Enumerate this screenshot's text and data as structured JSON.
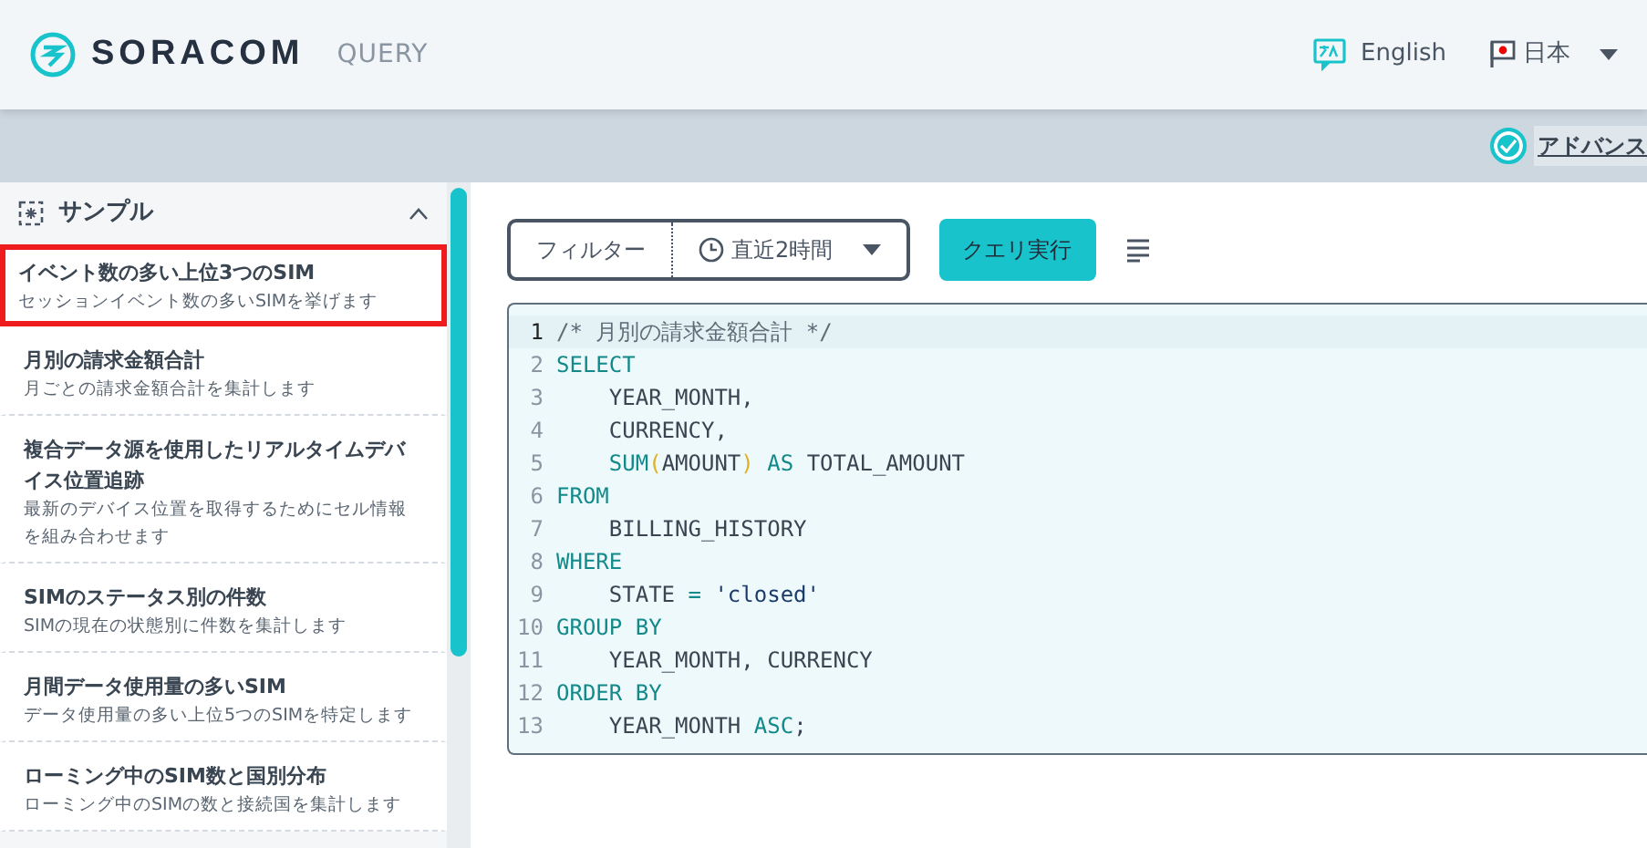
{
  "header": {
    "logo": "SORACOM",
    "product": "QUERY",
    "language": "English",
    "region": "日本"
  },
  "advanced_toggle": {
    "label": "アドバンス",
    "checked": true
  },
  "sidebar": {
    "title": "サンプル",
    "expanded": true,
    "items": [
      {
        "title": "イベント数の多い上位3つのSIM",
        "description": "セッションイベント数の多いSIMを挙げます",
        "selected": true
      },
      {
        "title": "月別の請求金額合計",
        "description": "月ごとの請求金額合計を集計します",
        "selected": false
      },
      {
        "title": "複合データ源を使用したリアルタイムデバイス位置追跡",
        "description": "最新のデバイス位置を取得するためにセル情報を組み合わせます",
        "selected": false
      },
      {
        "title": "SIMのステータス別の件数",
        "description": "SIMの現在の状態別に件数を集計します",
        "selected": false
      },
      {
        "title": "月間データ使用量の多いSIM",
        "description": "データ使用量の多い上位5つのSIMを特定します",
        "selected": false
      },
      {
        "title": "ローミング中のSIM数と国別分布",
        "description": "ローミング中のSIMの数と接続国を集計します",
        "selected": false
      }
    ]
  },
  "toolbar": {
    "filter": "フィルター",
    "time_range": "直近2時間",
    "run_button": "クエリ実行"
  },
  "editor": {
    "lines": [
      {
        "number": "1",
        "current": true,
        "tokens": [
          {
            "kind": "comment",
            "text": "/* 月別の請求金額合計 */"
          }
        ]
      },
      {
        "number": "2",
        "current": false,
        "tokens": [
          {
            "kind": "keyword",
            "text": "SELECT"
          }
        ]
      },
      {
        "number": "3",
        "current": false,
        "tokens": [
          {
            "kind": "plain",
            "text": "    YEAR_MONTH,"
          }
        ]
      },
      {
        "number": "4",
        "current": false,
        "tokens": [
          {
            "kind": "plain",
            "text": "    CURRENCY,"
          }
        ]
      },
      {
        "number": "5",
        "current": false,
        "tokens": [
          {
            "kind": "keyword",
            "text": "    SUM"
          },
          {
            "kind": "paren",
            "text": "("
          },
          {
            "kind": "plain",
            "text": "AMOUNT"
          },
          {
            "kind": "paren",
            "text": ")"
          },
          {
            "kind": "keyword",
            "text": " AS"
          },
          {
            "kind": "plain",
            "text": " TOTAL_AMOUNT"
          }
        ]
      },
      {
        "number": "6",
        "current": false,
        "tokens": [
          {
            "kind": "keyword",
            "text": "FROM"
          }
        ]
      },
      {
        "number": "7",
        "current": false,
        "tokens": [
          {
            "kind": "plain",
            "text": "    BILLING_HISTORY"
          }
        ]
      },
      {
        "number": "8",
        "current": false,
        "tokens": [
          {
            "kind": "keyword",
            "text": "WHERE"
          }
        ]
      },
      {
        "number": "9",
        "current": false,
        "tokens": [
          {
            "kind": "plain",
            "text": "    STATE "
          },
          {
            "kind": "keyword",
            "text": "="
          },
          {
            "kind": "string",
            "text": " 'closed'"
          }
        ]
      },
      {
        "number": "10",
        "current": false,
        "tokens": [
          {
            "kind": "keyword",
            "text": "GROUP BY"
          }
        ]
      },
      {
        "number": "11",
        "current": false,
        "tokens": [
          {
            "kind": "plain",
            "text": "    YEAR_MONTH, CURRENCY"
          }
        ]
      },
      {
        "number": "12",
        "current": false,
        "tokens": [
          {
            "kind": "keyword",
            "text": "ORDER BY"
          }
        ]
      },
      {
        "number": "13",
        "current": false,
        "tokens": [
          {
            "kind": "plain",
            "text": "    YEAR_MONTH "
          },
          {
            "kind": "keyword",
            "text": "ASC"
          },
          {
            "kind": "plain",
            "text": ";"
          }
        ]
      }
    ]
  }
}
